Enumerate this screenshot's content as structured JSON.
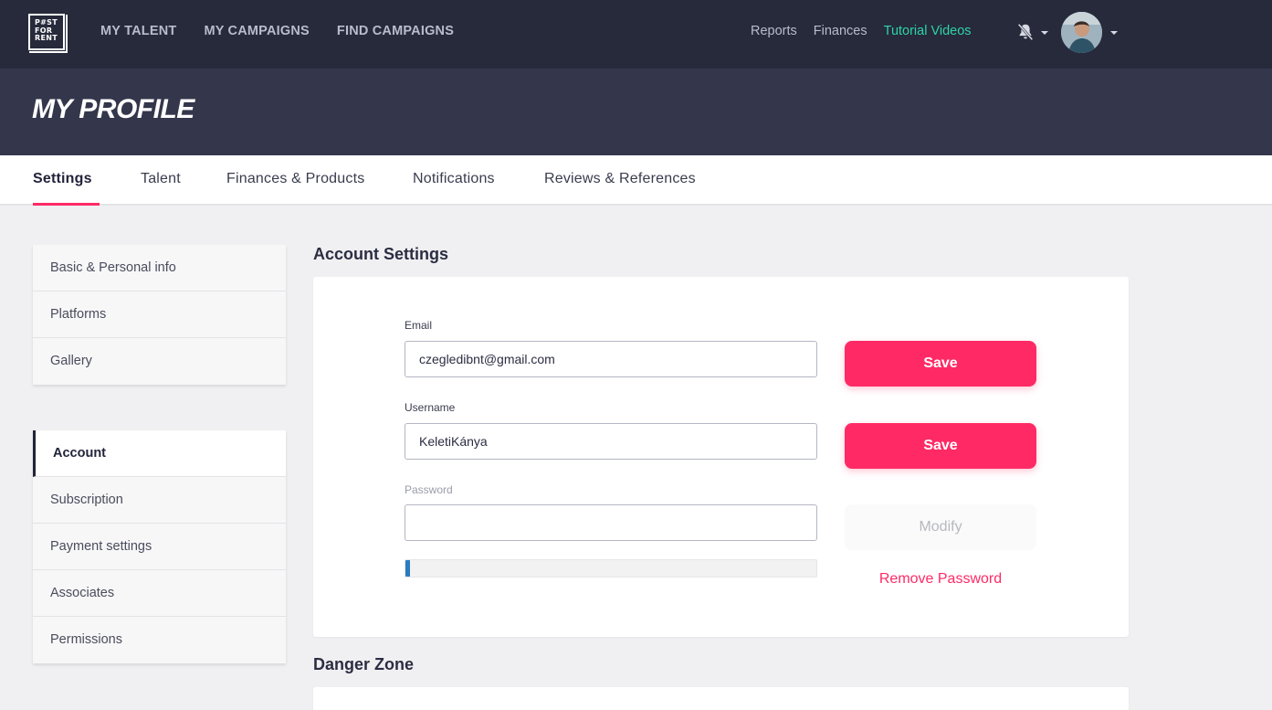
{
  "logo": {
    "lines": [
      "P#ST",
      "FOR",
      "RENT"
    ]
  },
  "nav": {
    "main": [
      "MY TALENT",
      "MY CAMPAIGNS",
      "FIND CAMPAIGNS"
    ],
    "right": [
      "Reports",
      "Finances",
      "Tutorial Videos"
    ],
    "accent_color": "#2fd4a8",
    "icons": [
      "bell-off-icon",
      "chevron-down-icon",
      "avatar"
    ]
  },
  "page": {
    "title": "MY PROFILE"
  },
  "tabs": {
    "items": [
      "Settings",
      "Talent",
      "Finances & Products",
      "Notifications",
      "Reviews & References"
    ],
    "active": "Settings"
  },
  "sidebar": {
    "group1": [
      "Basic & Personal info",
      "Platforms",
      "Gallery"
    ],
    "group2": [
      "Account",
      "Subscription",
      "Payment settings",
      "Associates",
      "Permissions"
    ],
    "active": "Account"
  },
  "account_settings": {
    "title": "Account Settings",
    "email": {
      "label": "Email",
      "value": "czegledibnt@gmail.com",
      "button": "Save"
    },
    "username": {
      "label": "Username",
      "value": "KeletiKánya",
      "button": "Save"
    },
    "password": {
      "label": "Password",
      "value": "",
      "button": "Modify",
      "strength_fraction": 0.01,
      "remove_link": "Remove Password"
    }
  },
  "danger_zone": {
    "title": "Danger Zone"
  },
  "colors": {
    "brand_pink": "#ff2a65",
    "nav_bg": "#262a3b",
    "hero_bg": "#34374b",
    "meter_blue": "#2b7bc0"
  }
}
